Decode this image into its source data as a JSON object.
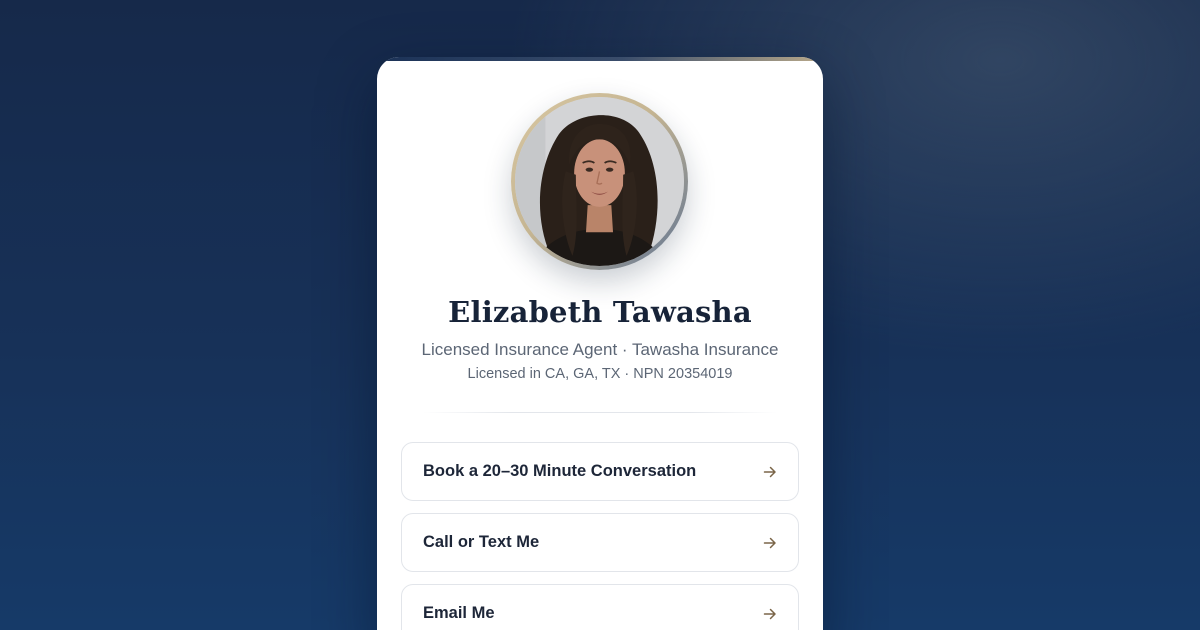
{
  "profile": {
    "name": "Elizabeth Tawasha",
    "role_line": "Licensed Insurance Agent · Tawasha Insurance",
    "license_line": "Licensed in CA, GA, TX · NPN 20354019",
    "avatar_icon": "profile-photo"
  },
  "links": [
    {
      "label": "Book a 20–30 Minute Conversation",
      "icon": "arrow-right-icon"
    },
    {
      "label": "Call or Text Me",
      "icon": "arrow-right-icon"
    },
    {
      "label": "Email Me",
      "icon": "arrow-right-icon"
    }
  ],
  "colors": {
    "background_top": "#16294a",
    "background_bottom": "#163a68",
    "card": "#ffffff",
    "accent_gold": "#c5b592",
    "name_text": "#172338",
    "muted_text": "#5c6675",
    "arrow": "#7a6548"
  }
}
